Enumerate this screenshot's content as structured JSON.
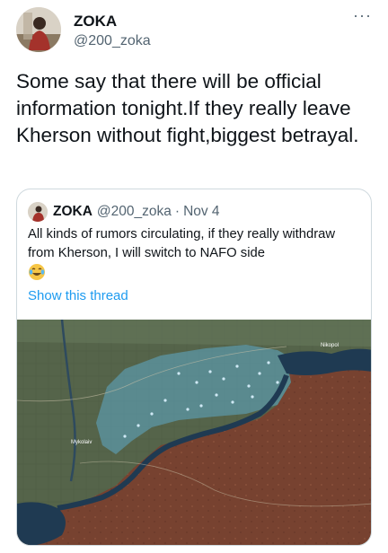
{
  "tweet": {
    "author_name": "ZOKA",
    "author_handle": "@200_zoka",
    "more_icon": "more-horizontal-icon",
    "text": "Some say that there will be official information tonight.If they really leave Kherson without fight,biggest betrayal."
  },
  "quoted_tweet": {
    "author_name": "ZOKA",
    "author_handle": "@200_zoka",
    "separator": "·",
    "date": "Nov 4",
    "text": "All kinds of rumors circulating, if they really withdraw from Kherson, I will switch to NAFO side",
    "emoji": "face-with-tears-of-joy",
    "show_thread_label": "Show this thread",
    "map": {
      "labels": [
        "Nikopol",
        "Mykolaiv"
      ],
      "colors": {
        "occupied_zone": "#7a3f2e",
        "contested_zone": "#5fa9c9",
        "river": "#1f3a52"
      }
    }
  },
  "colors": {
    "link": "#1d9bf0",
    "secondary_text": "#536471",
    "border": "#cfd9de"
  }
}
